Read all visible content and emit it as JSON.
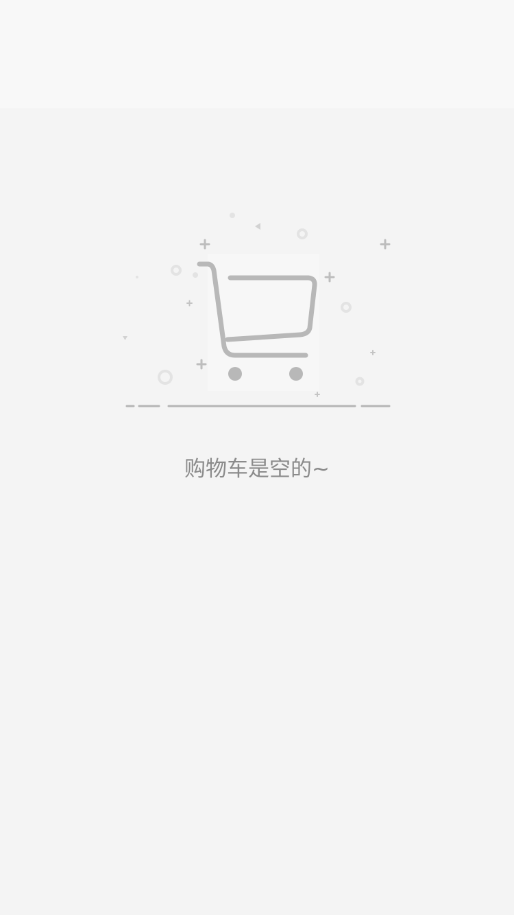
{
  "header": {},
  "empty_state": {
    "message": "购物车是空的~",
    "illustration_icon": "shopping-cart-icon",
    "colors": {
      "icon": "#b8b8b8",
      "decor_light": "#e3e3e3",
      "text": "#8b8b8b",
      "background": "#f4f4f4",
      "header_background": "#f8f8f8"
    }
  }
}
